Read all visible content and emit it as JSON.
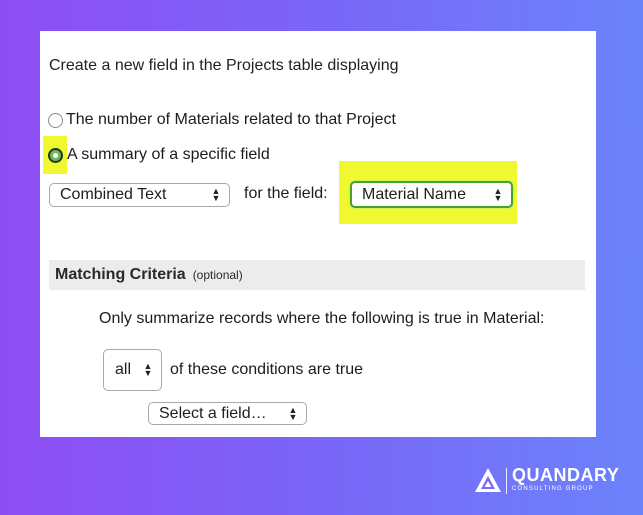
{
  "intro_text": "Create a new field in the Projects table displaying",
  "options": [
    {
      "label": "The number of Materials related to that Project",
      "checked": false
    },
    {
      "label": "A summary of a specific field",
      "checked": true
    }
  ],
  "summary_type_select": {
    "value": "Combined Text"
  },
  "for_field_label": "for the field:",
  "field_select": {
    "value": "Material Name"
  },
  "matching": {
    "title": "Matching Criteria",
    "optional": "(optional)",
    "description": "Only summarize records where the following is true in Material:",
    "quantifier_select": {
      "value": "all"
    },
    "conditions_text": "of these conditions are true",
    "field_picker": {
      "value": "Select a field…"
    }
  },
  "logo": {
    "name": "QUANDARY",
    "tagline": "CONSULTING GROUP"
  },
  "colors": {
    "highlight": "#f0f82f",
    "radio_checked": "#6fb85b",
    "section_bar": "#ececec"
  }
}
